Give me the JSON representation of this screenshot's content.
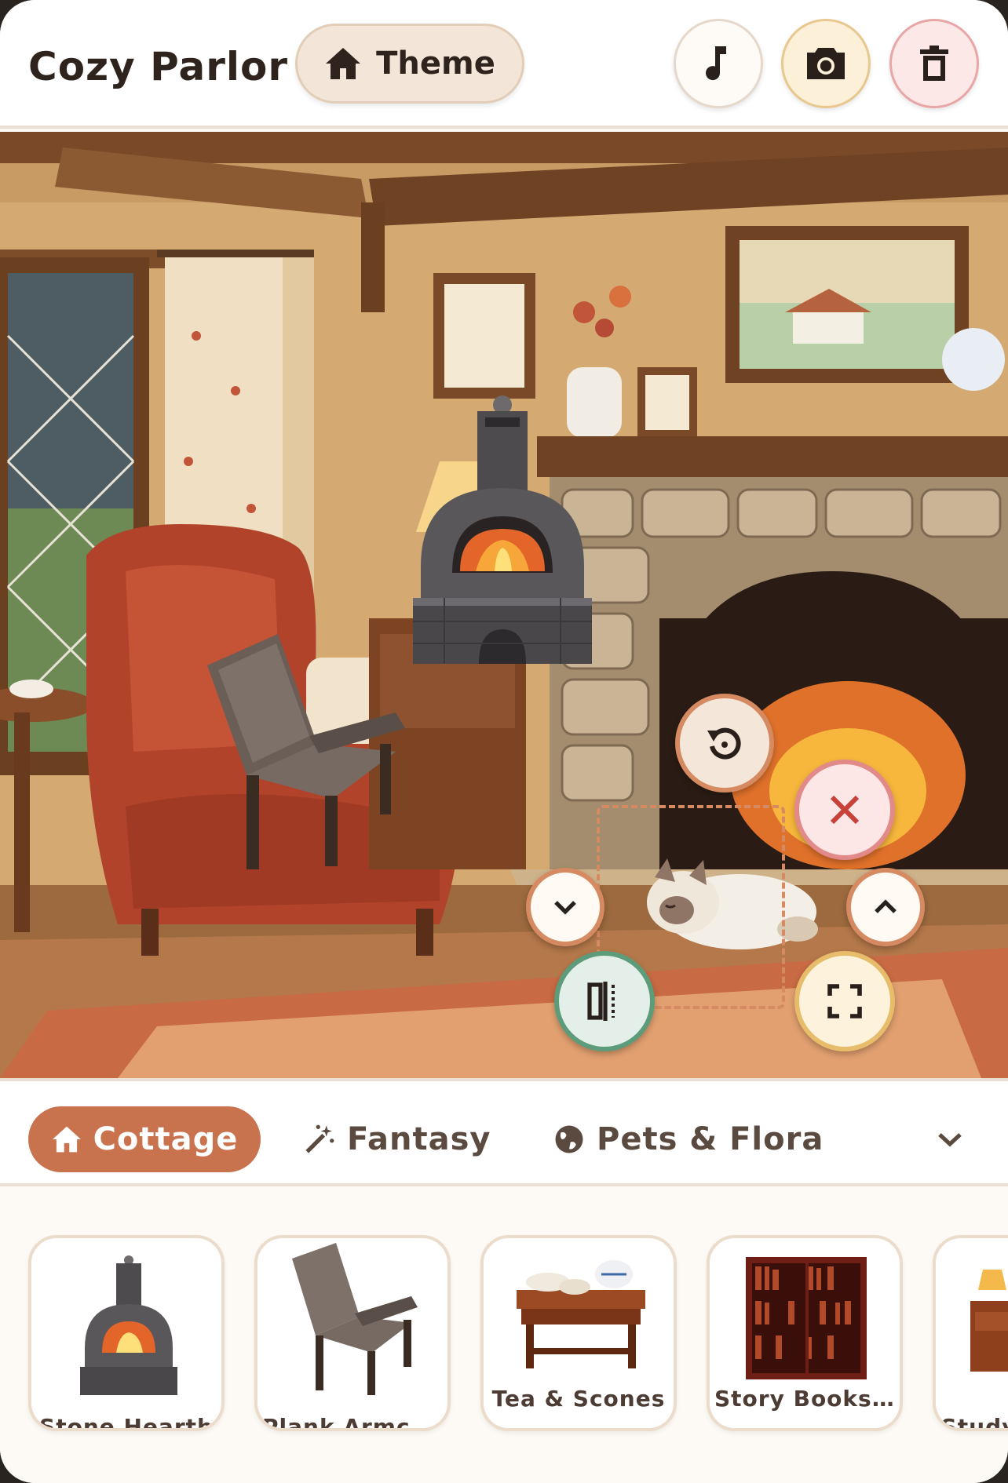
{
  "header": {
    "title": "Cozy Parlor",
    "theme_label": "Theme",
    "buttons": [
      {
        "name": "music",
        "icon": "music-note-icon"
      },
      {
        "name": "camera",
        "icon": "camera-icon"
      },
      {
        "name": "trash",
        "icon": "trash-icon"
      }
    ]
  },
  "scene": {
    "placed_items": [
      "Stone Hearth",
      "Plank Armchair",
      "Sleeping Cat"
    ],
    "selection_controls": [
      "rotate-icon",
      "close-icon",
      "chevron-down-icon",
      "chevron-up-icon",
      "flip-icon",
      "fullscreen-icon"
    ]
  },
  "categories": {
    "tabs": [
      {
        "label": "Cottage",
        "icon": "home-icon",
        "active": true
      },
      {
        "label": "Fantasy",
        "icon": "magic-wand-icon",
        "active": false
      },
      {
        "label": "Pets & Flora",
        "icon": "globe-icon",
        "active": false
      }
    ],
    "more_icon": "chevron-down-icon"
  },
  "tray": {
    "items": [
      {
        "label": "Stone Hearth"
      },
      {
        "label": "Plank Armchair"
      },
      {
        "label": "Tea & Scones"
      },
      {
        "label": "Story Books..."
      },
      {
        "label": "Study"
      }
    ]
  },
  "colors": {
    "accent": "#c9724e",
    "background": "#fdfaf5",
    "delete": "#e28a8a",
    "flip": "#5d9c7a",
    "resize": "#e7bc6b"
  }
}
